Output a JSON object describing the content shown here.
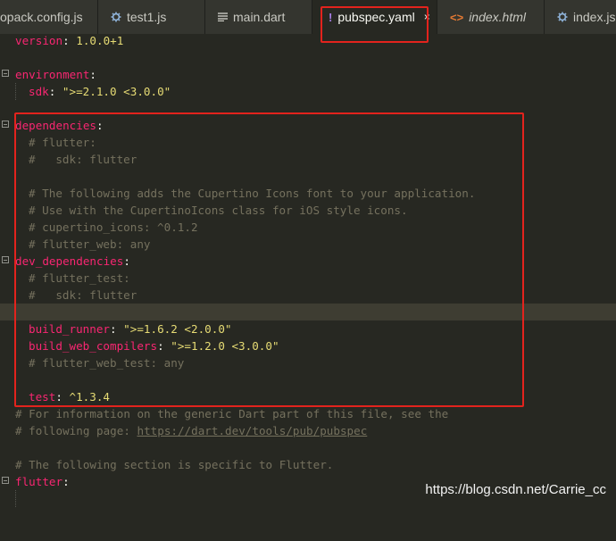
{
  "tabs": [
    {
      "label": "opack.config.js",
      "icon": "none",
      "active": false
    },
    {
      "label": "test1.js",
      "icon": "gear-icon",
      "active": false
    },
    {
      "label": "main.dart",
      "icon": "lines-icon",
      "active": false
    },
    {
      "label": "pubspec.yaml",
      "icon": "exclamation-icon",
      "active": true,
      "close": "×"
    },
    {
      "label": "index.html",
      "icon": "code-brackets-icon",
      "active": false
    },
    {
      "label": "index.js",
      "icon": "gear-icon",
      "active": false
    }
  ],
  "tab_glyphs": {
    "exclamation": "!",
    "brackets": "<>"
  },
  "colors": {
    "editor_bg": "#272822",
    "key": "#f92672",
    "string": "#e6db74",
    "comment": "#75715e",
    "highlight_box": "#e3231d"
  },
  "code": {
    "l0_key": "version",
    "l0_colon": ":",
    "l0_val": " 1.0.0+1",
    "l2_key": "environment",
    "l2_colon": ":",
    "l3_key": "sdk",
    "l3_colon": ":",
    "l3_val": " \">=2.1.0 <3.0.0\"",
    "l5_key": "dependencies",
    "l5_colon": ":",
    "l6": "# flutter:",
    "l7": "#   sdk: flutter",
    "l9": "# The following adds the Cupertino Icons font to your application.",
    "l10": "# Use with the CupertinoIcons class for iOS style icons.",
    "l11": "# cupertino_icons: ^0.1.2",
    "l12": "# flutter_web: any",
    "l13_key": "dev_dependencies",
    "l13_colon": ":",
    "l14": "# flutter_test:",
    "l15": "#   sdk: flutter",
    "l17_key": "build_runner",
    "l17_colon": ":",
    "l17_val": " \">=1.6.2 <2.0.0\"",
    "l18_key": "build_web_compilers",
    "l18_colon": ":",
    "l18_val": " \">=1.2.0 <3.0.0\"",
    "l19": "# flutter_web_test: any",
    "l21_key": "test",
    "l21_colon": ":",
    "l21_val": " ^1.3.4",
    "l22": "# For information on the generic Dart part of this file, see the",
    "l23_pre": "# following page: ",
    "l23_link": "https://dart.dev/tools/pub/pubspec",
    "l25": "# The following section is specific to Flutter.",
    "l26_key": "flutter",
    "l26_colon": ":"
  },
  "watermark": "https://blog.csdn.net/Carrie_cc"
}
